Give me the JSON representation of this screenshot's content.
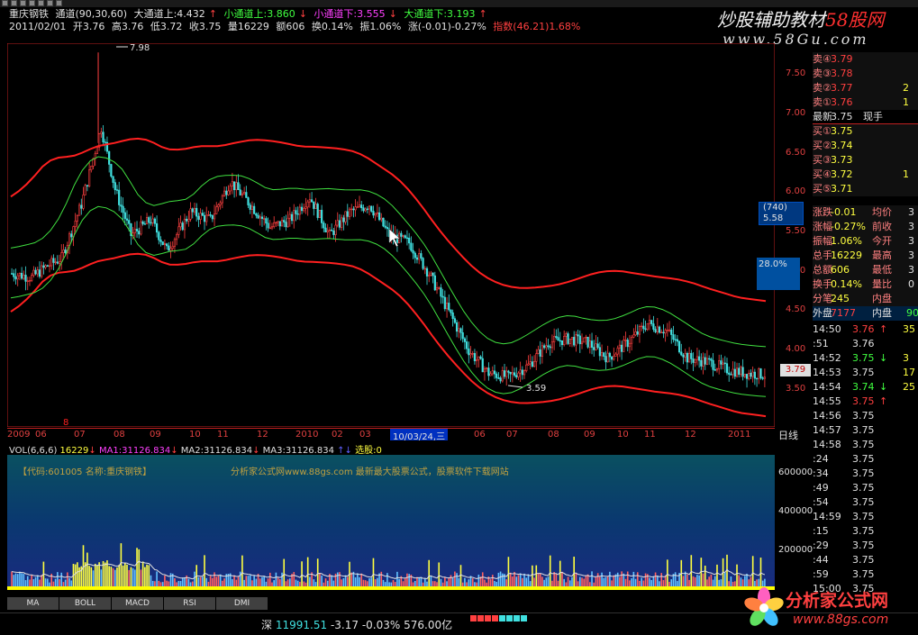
{
  "header": {
    "stock_name": "重庆钢铁",
    "indicator": "通道(90,30,60)",
    "big_up_label": "大通道上:4.432",
    "small_up_label": "小通道上:3.860",
    "small_down_label": "小通道下:3.555",
    "big_down_label": "大通道下:3.193",
    "date": "2011/02/01",
    "open": "开3.76",
    "high": "高3.76",
    "low": "低3.72",
    "close": "收3.75",
    "volume": "量16229",
    "amount": "额606",
    "turnover": "换0.14%",
    "amplitude": "振1.06%",
    "change": "涨(-0.01)-0.27%",
    "index": "指数(46.21)1.68%"
  },
  "watermark": {
    "line1": "炒股辅助教材",
    "line1_accent": "58股网",
    "line2": "www.58Gu.com"
  },
  "chart": {
    "high_label": "7.98",
    "low_label": "3.59",
    "price_ticks": [
      "7.50",
      "7.00",
      "6.50",
      "6.00",
      "5.50",
      "5.00",
      "4.50",
      "4.00",
      "3.50"
    ],
    "zf_box": [
      "(740)",
      "5.58"
    ],
    "pct_box": "28.0%",
    "current_price": "3.79",
    "x_labels": [
      "2009",
      "06",
      "07",
      "08",
      "09",
      "10",
      "11",
      "12",
      "2010",
      "02",
      "03",
      "06",
      "07",
      "08",
      "09",
      "10",
      "11",
      "12",
      "2011"
    ],
    "x_selected": "10/03/24,三",
    "period_label": "日线",
    "red_mark": "8"
  },
  "volume": {
    "header_vol": "VOL(6,6,6)",
    "vol_value": "16229",
    "ma1": "MA1:31126.834",
    "ma2": "MA2:31126.834",
    "ma3": "MA3:31126.834",
    "select": "选股:0",
    "info": "【代码:601005 名称:重庆钢铁】",
    "info2": "分析家公式网www.88gs.com 最新最大股票公式，股票软件下载网站",
    "ticks": [
      "600000",
      "400000",
      "200000"
    ]
  },
  "bottom_tabs": [
    "MA",
    "BOLL",
    "MACD",
    "RSI",
    "DMI"
  ],
  "status": {
    "market": "深",
    "index_value": "11991.51",
    "change": "-3.17",
    "pct": "-0.03%",
    "amount": "576.00亿"
  },
  "quote": {
    "asks": [
      {
        "label": "卖④",
        "price": "3.79",
        "vol": ""
      },
      {
        "label": "卖③",
        "price": "3.78",
        "vol": ""
      },
      {
        "label": "卖②",
        "price": "3.77",
        "vol": "2"
      },
      {
        "label": "卖①",
        "price": "3.76",
        "vol": "1"
      }
    ],
    "latest": {
      "label": "最新",
      "price": "3.75",
      "extra": "现手"
    },
    "bids": [
      {
        "label": "买①",
        "price": "3.75",
        "vol": ""
      },
      {
        "label": "买②",
        "price": "3.74",
        "vol": ""
      },
      {
        "label": "买③",
        "price": "3.73",
        "vol": ""
      },
      {
        "label": "买④",
        "price": "3.72",
        "vol": "1"
      },
      {
        "label": "买⑤",
        "price": "3.71",
        "vol": ""
      }
    ],
    "stats": [
      {
        "label": "涨跌",
        "value": "-0.01",
        "label2": "均价",
        "value2": "3"
      },
      {
        "label": "涨幅",
        "value": "-0.27%",
        "label2": "前收",
        "value2": "3"
      },
      {
        "label": "振幅",
        "value": "1.06%",
        "label2": "今开",
        "value2": "3"
      },
      {
        "label": "总手",
        "value": "16229",
        "label2": "最高",
        "value2": "3"
      },
      {
        "label": "总额",
        "value": "606",
        "label2": "最低",
        "value2": "3"
      },
      {
        "label": "换手",
        "value": "0.14%",
        "label2": "量比",
        "value2": "0"
      },
      {
        "label": "分笔",
        "value": "245",
        "label2": "内盘",
        "value2": ""
      }
    ],
    "outer_inner": {
      "outer": "外盘",
      "outer_val": "7177",
      "inner": "内盘",
      "inner_val": "90"
    },
    "ticks": [
      {
        "time": "14:50",
        "price": "3.76",
        "arrow": "↑",
        "vol": "35"
      },
      {
        "time": ":51",
        "price": "3.76",
        "arrow": "",
        "vol": ""
      },
      {
        "time": "14:52",
        "price": "3.75",
        "arrow": "↓",
        "vol": "3"
      },
      {
        "time": "14:53",
        "price": "3.75",
        "arrow": "",
        "vol": "17"
      },
      {
        "time": "14:54",
        "price": "3.74",
        "arrow": "↓",
        "vol": "25"
      },
      {
        "time": "14:55",
        "price": "3.75",
        "arrow": "↑",
        "vol": ""
      },
      {
        "time": "14:56",
        "price": "3.75",
        "arrow": "",
        "vol": ""
      },
      {
        "time": "14:57",
        "price": "3.75",
        "arrow": "",
        "vol": ""
      },
      {
        "time": "14:58",
        "price": "3.75",
        "arrow": "",
        "vol": ""
      },
      {
        "time": ":24",
        "price": "3.75",
        "arrow": "",
        "vol": ""
      },
      {
        "time": ":34",
        "price": "3.75",
        "arrow": "",
        "vol": ""
      },
      {
        "time": ":49",
        "price": "3.75",
        "arrow": "",
        "vol": ""
      },
      {
        "time": ":54",
        "price": "3.75",
        "arrow": "",
        "vol": ""
      },
      {
        "time": "14:59",
        "price": "3.75",
        "arrow": "",
        "vol": ""
      },
      {
        "time": ":15",
        "price": "3.75",
        "arrow": "",
        "vol": ""
      },
      {
        "time": ":29",
        "price": "3.75",
        "arrow": "",
        "vol": ""
      },
      {
        "time": ":44",
        "price": "3.75",
        "arrow": "",
        "vol": ""
      },
      {
        "time": ":59",
        "price": "3.75",
        "arrow": "",
        "vol": ""
      },
      {
        "time": "15:00",
        "price": "3.75",
        "arrow": "",
        "vol": ""
      }
    ]
  },
  "logo": {
    "name": "分析家公式网",
    "url": "www.88gs.com"
  },
  "colors": {
    "up": "#ff4040",
    "down": "#40ff40",
    "band_big": "#ff2020",
    "band_small": "#40e040",
    "volume_bg": "#0a2a6a"
  }
}
